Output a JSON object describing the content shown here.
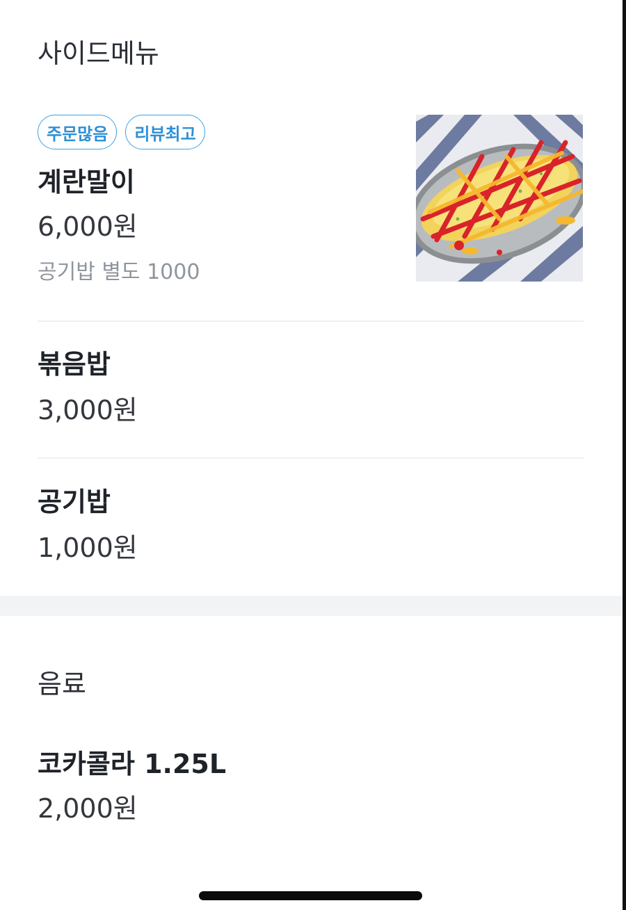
{
  "side_menu": {
    "title": "사이드메뉴",
    "items": [
      {
        "badges": [
          "주문많음",
          "리뷰최고"
        ],
        "name": "계란말이",
        "price": "6,000원",
        "note": "공기밥 별도 1000",
        "image": "rolled-omelette-photo"
      },
      {
        "name": "볶음밥",
        "price": "3,000원"
      },
      {
        "name": "공기밥",
        "price": "1,000원"
      }
    ]
  },
  "drinks": {
    "title": "음료",
    "items": [
      {
        "name": "코카콜라 1.25L",
        "price": "2,000원"
      }
    ]
  },
  "colors": {
    "badge_border": "#3aa3e6",
    "badge_text": "#2e8fd6",
    "section_gap": "#f2f3f5",
    "ketchup": "#d9232a",
    "mustard": "#f5b82e"
  }
}
